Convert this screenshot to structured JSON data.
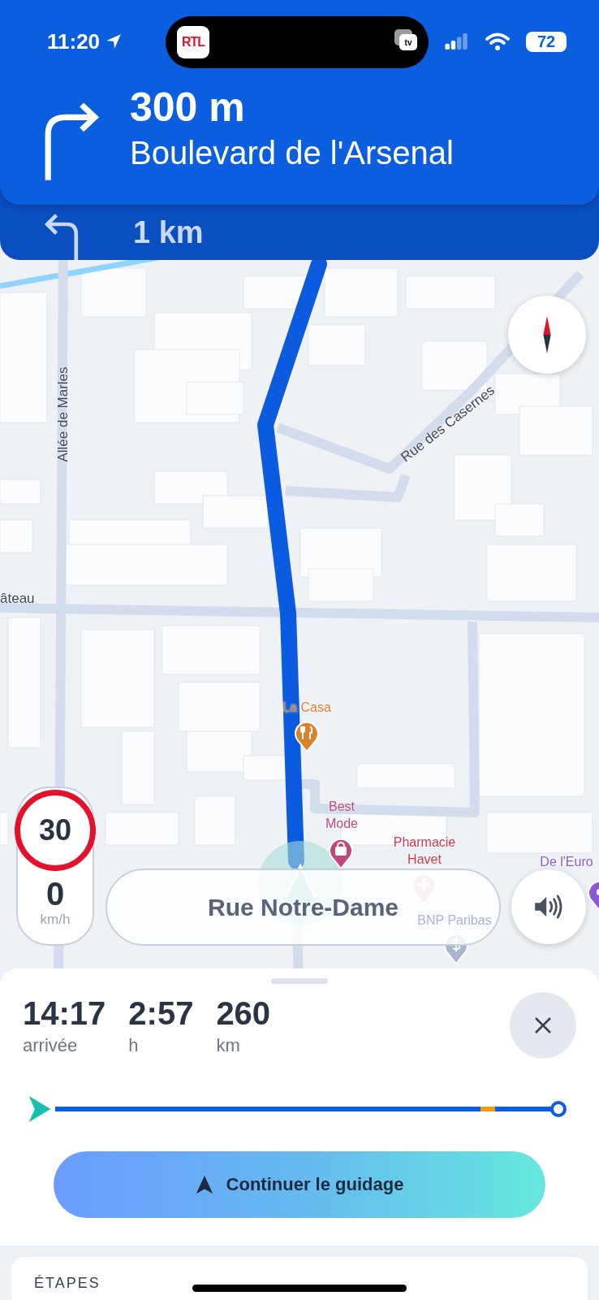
{
  "status_bar": {
    "time": "11:20",
    "battery": "72"
  },
  "dynamic_island": {
    "app_logo": "RTL",
    "device_badge": "tv"
  },
  "instruction": {
    "distance": "300 m",
    "street": "Boulevard de l'Arsenal"
  },
  "next_instruction": {
    "distance": "1 km"
  },
  "map": {
    "streets": [
      {
        "name": "Allée de Marles"
      },
      {
        "name": "Rue des Casernes"
      },
      {
        "name": "âteau"
      }
    ],
    "pois": [
      {
        "name": "La Casa",
        "kind": "restaurant",
        "color": "#d9822b"
      },
      {
        "name": "Best Mode",
        "kind": "shop",
        "color": "#c2477a"
      },
      {
        "name": "Pharmacie Havet",
        "kind": "pharmacy",
        "color": "#d23a4e"
      },
      {
        "name": "BNP Paribas",
        "kind": "bank",
        "color": "#a9b4d0"
      },
      {
        "name": "De l'Euro",
        "kind": "other",
        "color": "#8a5cd0"
      }
    ]
  },
  "speed": {
    "limit": "30",
    "current": "0",
    "unit": "km/h"
  },
  "current_street": "Rue Notre-Dame",
  "trip": {
    "stats": [
      {
        "value": "14:17",
        "label": "arrivée"
      },
      {
        "value": "2:57",
        "label": "h"
      },
      {
        "value": "260",
        "label": "km"
      }
    ],
    "level": 0
  },
  "continue_button": "Continuer le guidage",
  "steps_heading": "ÉTAPES"
}
